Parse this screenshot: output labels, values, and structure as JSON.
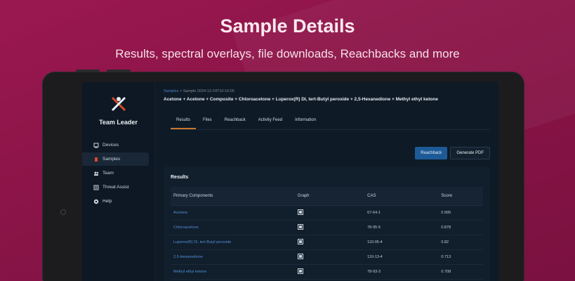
{
  "hero": {
    "title": "Sample Details",
    "subtitle": "Results, spectral overlays, file downloads, Reachbacks and more"
  },
  "app": {
    "brand": "Team Leader",
    "nav": [
      {
        "label": "Devices",
        "icon": "device-icon"
      },
      {
        "label": "Samples",
        "icon": "sample-icon",
        "active": true
      },
      {
        "label": "Team",
        "icon": "team-icon"
      },
      {
        "label": "Threat Assist",
        "icon": "threat-icon"
      },
      {
        "label": "Help",
        "icon": "help-icon"
      }
    ]
  },
  "page": {
    "breadcrumb_root": "Samples",
    "breadcrumb_current": "Sample 2024-12-24T10:10:05",
    "sample_title": "Acetone + Acetone + Composite + Chloroacetone + Luperox(R) DI, tert-Butyl peroxide + 2,5-Hexanedione + Methyl ethyl ketone",
    "tabs": [
      {
        "label": "Results",
        "active": true
      },
      {
        "label": "Files"
      },
      {
        "label": "Reachback"
      },
      {
        "label": "Activity Feed"
      },
      {
        "label": "Information"
      }
    ],
    "reachback_button": "Reachback",
    "pdf_button": "Generate PDF"
  },
  "results": {
    "title": "Results",
    "headers": [
      "Primary Components",
      "Graph",
      "CAS",
      "Score"
    ],
    "rows": [
      {
        "name": "Acetone",
        "cas": "67-64-1",
        "score": "0.995"
      },
      {
        "name": "Chloroacetone",
        "cas": "78-95-5",
        "score": "0.878"
      },
      {
        "name": "Luperox(R) DI, tert-Butyl peroxide",
        "cas": "110-05-4",
        "score": "0.82"
      },
      {
        "name": "2,5-Hexanedione",
        "cas": "110-13-4",
        "score": "0.713"
      },
      {
        "name": "Methyl ethyl ketone",
        "cas": "78-93-3",
        "score": "0.708"
      }
    ]
  },
  "colors": {
    "background": "#8a1447",
    "accent_tab": "#c9762a",
    "primary_button": "#1d5a98",
    "link": "#4f8fd8"
  }
}
